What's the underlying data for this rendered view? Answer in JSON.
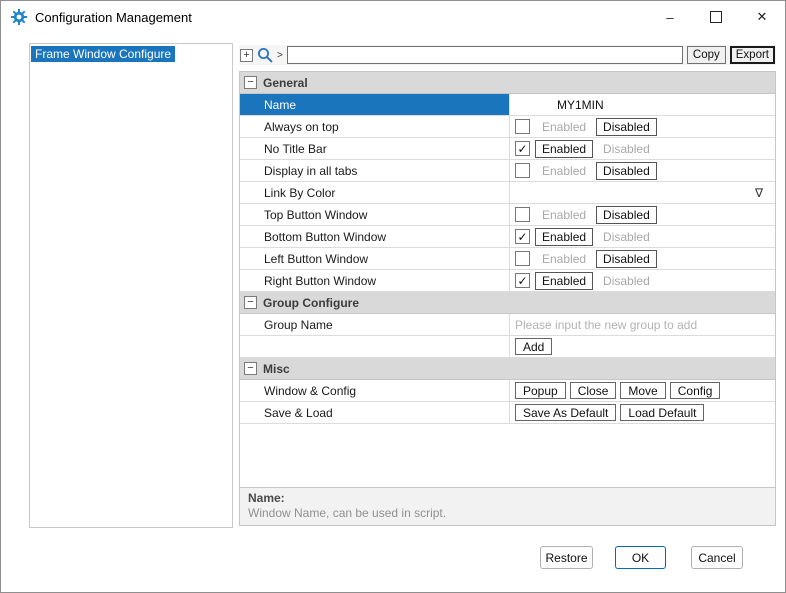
{
  "window": {
    "title": "Configuration Management"
  },
  "titlebar": {
    "minimize_glyph": "–",
    "close_glyph": "✕"
  },
  "sidebar": {
    "items": [
      {
        "label": "Frame Window Configure",
        "selected": true
      }
    ]
  },
  "toolbar": {
    "expand_glyph": "+",
    "arrow_glyph": ">",
    "search_value": "",
    "copy_label": "Copy",
    "export_label": "Export"
  },
  "grid": {
    "sections": [
      {
        "glyph": "−",
        "title": "General"
      },
      {
        "glyph": "−",
        "title": "Group Configure"
      },
      {
        "glyph": "−",
        "title": "Misc"
      }
    ],
    "rows": {
      "name": {
        "label": "Name",
        "value": "MY1MIN"
      },
      "always_on_top": {
        "label": "Always on top",
        "check": "",
        "enabled": "Enabled",
        "disabled": "Disabled",
        "enabled_state": "off",
        "disabled_state": "on"
      },
      "no_title_bar": {
        "label": "No Title Bar",
        "check": "✓",
        "enabled": "Enabled",
        "disabled": "Disabled",
        "enabled_state": "on",
        "disabled_state": "off"
      },
      "display_in_all_tabs": {
        "label": "Display in all tabs",
        "check": "",
        "enabled": "Enabled",
        "disabled": "Disabled",
        "enabled_state": "off",
        "disabled_state": "on"
      },
      "link_by_color": {
        "label": "Link By Color",
        "value": "",
        "dropdown_glyph": "∇"
      },
      "top_button_window": {
        "label": "Top Button Window",
        "check": "",
        "enabled": "Enabled",
        "disabled": "Disabled",
        "enabled_state": "off",
        "disabled_state": "on"
      },
      "bottom_button_window": {
        "label": "Bottom Button Window",
        "check": "✓",
        "enabled": "Enabled",
        "disabled": "Disabled",
        "enabled_state": "on",
        "disabled_state": "off"
      },
      "left_button_window": {
        "label": "Left Button Window",
        "check": "",
        "enabled": "Enabled",
        "disabled": "Disabled",
        "enabled_state": "off",
        "disabled_state": "on"
      },
      "right_button_window": {
        "label": "Right Button Window",
        "check": "✓",
        "enabled": "Enabled",
        "disabled": "Disabled",
        "enabled_state": "on",
        "disabled_state": "off"
      },
      "group_name": {
        "label": "Group Name",
        "placeholder": "Please input the new group to add"
      },
      "group_add": {
        "label": "",
        "button": "Add"
      },
      "window_config": {
        "label": "Window & Config",
        "buttons": [
          "Popup",
          "Close",
          "Move",
          "Config"
        ]
      },
      "save_load": {
        "label": "Save & Load",
        "buttons": [
          "Save As Default",
          "Load Default"
        ]
      }
    }
  },
  "description": {
    "title": "Name:",
    "text": "Window Name, can be used in script."
  },
  "footer": {
    "restore": "Restore",
    "ok": "OK",
    "cancel": "Cancel"
  }
}
